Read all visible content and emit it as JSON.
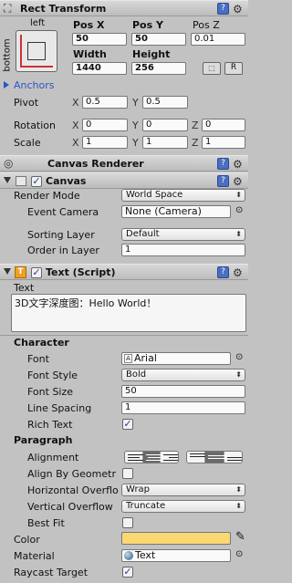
{
  "rect_transform": {
    "title": "Rect Transform",
    "anchor_preset": {
      "left": "left",
      "bottom": "bottom"
    },
    "pos_x": {
      "label": "Pos X",
      "value": "50"
    },
    "pos_y": {
      "label": "Pos Y",
      "value": "50"
    },
    "pos_z": {
      "label": "Pos Z",
      "value": "0.01"
    },
    "width": {
      "label": "Width",
      "value": "1440"
    },
    "height": {
      "label": "Height",
      "value": "256"
    },
    "raw_button": "R",
    "anchors_label": "Anchors",
    "pivot": {
      "label": "Pivot",
      "x": "0.5",
      "y": "0.5"
    },
    "rotation": {
      "label": "Rotation",
      "x": "0",
      "y": "0",
      "z": "0"
    },
    "scale": {
      "label": "Scale",
      "x": "1",
      "y": "1",
      "z": "1"
    },
    "axes": {
      "x": "X",
      "y": "Y",
      "z": "Z"
    }
  },
  "canvas_renderer": {
    "title": "Canvas Renderer"
  },
  "canvas": {
    "title": "Canvas",
    "render_mode": {
      "label": "Render Mode",
      "value": "World Space"
    },
    "event_camera": {
      "label": "Event Camera",
      "value": "None (Camera)"
    },
    "sorting_layer": {
      "label": "Sorting Layer",
      "value": "Default"
    },
    "order_in_layer": {
      "label": "Order in Layer",
      "value": "1"
    }
  },
  "text_script": {
    "title": "Text (Script)",
    "text_label": "Text",
    "text_value": "3D文字深度图：Hello World！",
    "character_header": "Character",
    "font": {
      "label": "Font",
      "value": "Arial"
    },
    "font_style": {
      "label": "Font Style",
      "value": "Bold"
    },
    "font_size": {
      "label": "Font Size",
      "value": "50"
    },
    "line_spacing": {
      "label": "Line Spacing",
      "value": "1"
    },
    "rich_text": {
      "label": "Rich Text",
      "checked": true
    },
    "paragraph_header": "Paragraph",
    "alignment": {
      "label": "Alignment",
      "horizontal_selected": "center",
      "vertical_selected": "middle"
    },
    "align_by_geometry": {
      "label": "Align By Geometr",
      "checked": false
    },
    "horizontal_overflow": {
      "label": "Horizontal Overflo",
      "value": "Wrap"
    },
    "vertical_overflow": {
      "label": "Vertical Overflow",
      "value": "Truncate"
    },
    "best_fit": {
      "label": "Best Fit",
      "checked": false
    },
    "color": {
      "label": "Color",
      "value": "#fcd875"
    },
    "material": {
      "label": "Material",
      "value": "Text"
    },
    "raycast_target": {
      "label": "Raycast Target",
      "checked": true
    }
  }
}
